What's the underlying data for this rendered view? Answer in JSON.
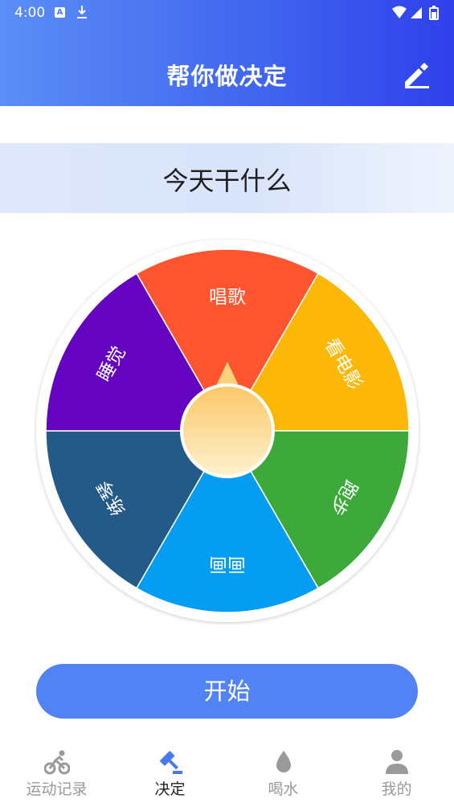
{
  "status_bar": {
    "time": "4:00",
    "notification_icons": [
      "font-icon",
      "download-icon"
    ],
    "system_icons": [
      "wifi-icon",
      "signal-icon",
      "battery-icon"
    ]
  },
  "header": {
    "title": "帮你做决定",
    "edit_icon": "pencil-icon",
    "gradient_colors": [
      "#5b8ef6",
      "#2f40ec"
    ]
  },
  "question": "今天干什么",
  "wheel": {
    "options": [
      {
        "label": "唱歌",
        "color": "#fe5531"
      },
      {
        "label": "看电影",
        "color": "#fdb807"
      },
      {
        "label": "跑步",
        "color": "#3da93a"
      },
      {
        "label": "画画",
        "color": "#049df1"
      },
      {
        "label": "练琴",
        "color": "#235a87"
      },
      {
        "label": "睡觉",
        "color": "#6404c1"
      }
    ],
    "pointer_direction": "up"
  },
  "start_button": "开始",
  "bottom_nav": {
    "items": [
      {
        "label": "运动记录",
        "icon": "bike-icon"
      },
      {
        "label": "决定",
        "icon": "gavel-icon"
      },
      {
        "label": "喝水",
        "icon": "water-drop-icon"
      },
      {
        "label": "我的",
        "icon": "person-icon"
      }
    ],
    "active_index": 1,
    "active_color": "#4a79ef",
    "inactive_color": "#9a9a9a"
  }
}
